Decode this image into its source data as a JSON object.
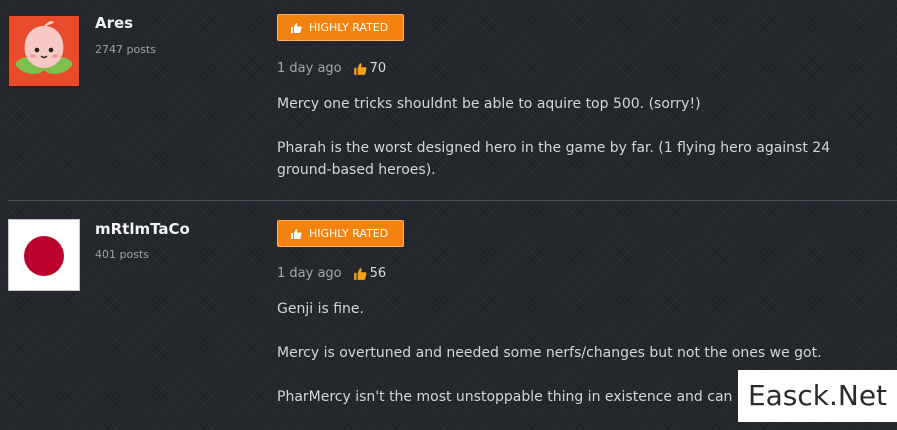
{
  "posts": [
    {
      "username": "Ares",
      "post_count": "2747 posts",
      "badge_label": "HIGHLY RATED",
      "time": "1 day ago",
      "likes": "70",
      "avatar": "peach-mascot",
      "paragraphs": [
        "Mercy one tricks shouldnt be able to aquire top 500. (sorry!)",
        "Pharah is the worst designed hero in the game by far. (1 flying hero against 24 ground-based heroes)."
      ]
    },
    {
      "username": "mRtlmTaCo",
      "post_count": "401 posts",
      "badge_label": "HIGHLY RATED",
      "time": "1 day ago",
      "likes": "56",
      "avatar": "japan-flag",
      "paragraphs": [
        "Genji is fine.",
        "Mercy is overtuned and needed some nerfs/changes but not the ones we got.",
        "PharMercy isn't the most unstoppable thing in existence and can b"
      ]
    }
  ],
  "watermark": "Easck.Net",
  "colors": {
    "badge": "#f4820f",
    "background": "#24272d",
    "flag_red": "#bc002d"
  }
}
